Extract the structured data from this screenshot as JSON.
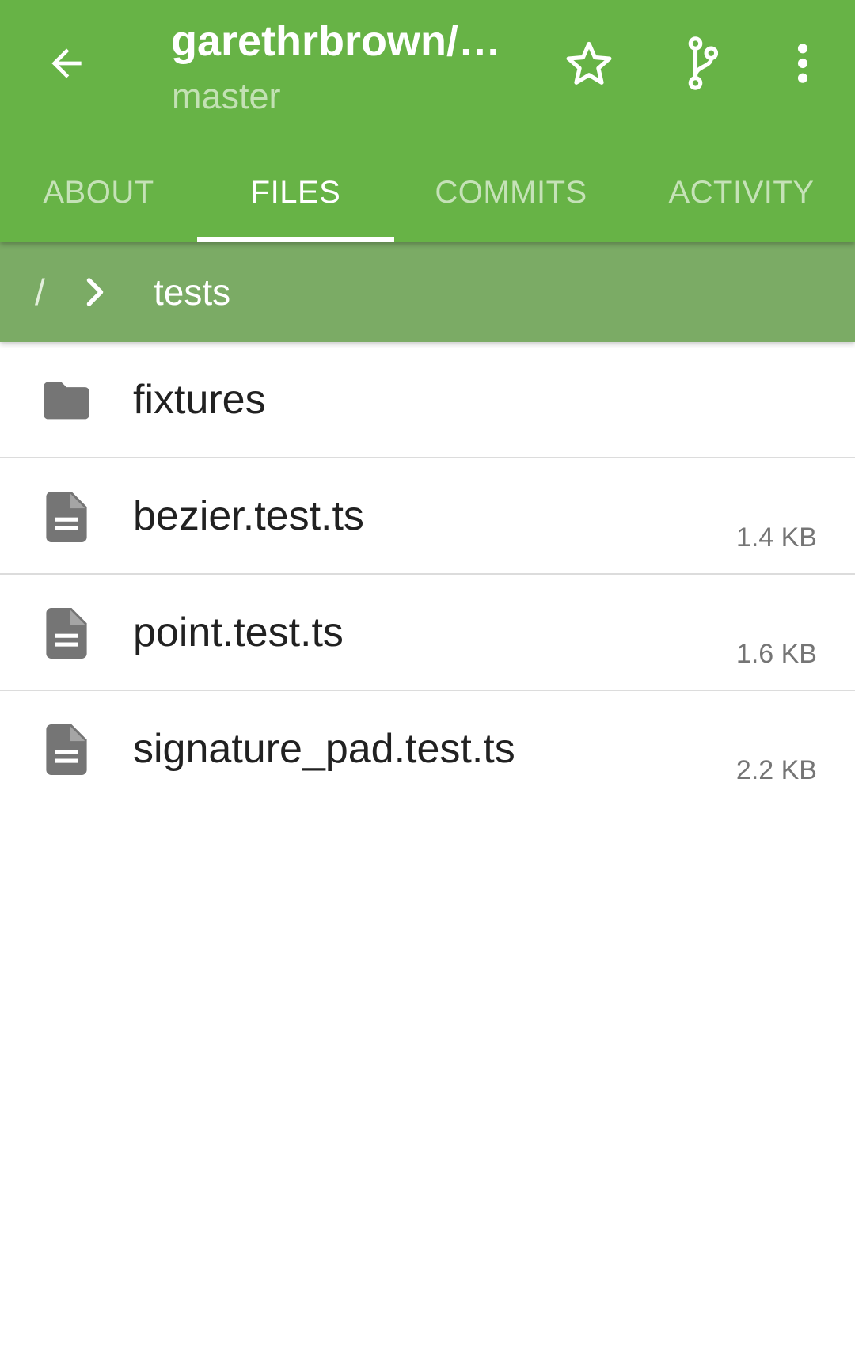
{
  "toolbar": {
    "title": "garethrbrown/…",
    "subtitle": "master",
    "back_icon": "arrow-back-icon",
    "actions": [
      {
        "icon": "star-outline-icon"
      },
      {
        "icon": "branch-icon"
      },
      {
        "icon": "more-vert-icon"
      }
    ]
  },
  "tabs": [
    {
      "label": "ABOUT",
      "active": false
    },
    {
      "label": "FILES",
      "active": true
    },
    {
      "label": "COMMITS",
      "active": false
    },
    {
      "label": "ACTIVITY",
      "active": false
    }
  ],
  "breadcrumb": {
    "root": "/",
    "separator_icon": "chevron-right-icon",
    "current": "tests"
  },
  "files": [
    {
      "name": "fixtures",
      "type": "folder",
      "icon": "folder-icon",
      "size": ""
    },
    {
      "name": "bezier.test.ts",
      "type": "file",
      "icon": "file-document-icon",
      "size": "1.4 KB"
    },
    {
      "name": "point.test.ts",
      "type": "file",
      "icon": "file-document-icon",
      "size": "1.6 KB"
    },
    {
      "name": "signature_pad.test.ts",
      "type": "file",
      "icon": "file-document-icon",
      "size": "2.2 KB"
    }
  ],
  "colors": {
    "toolbar": "#67b346",
    "breadcrumb_bar": "#7bab65",
    "inactive_tab": "#c5e2b7",
    "icon_gray": "#757575"
  }
}
